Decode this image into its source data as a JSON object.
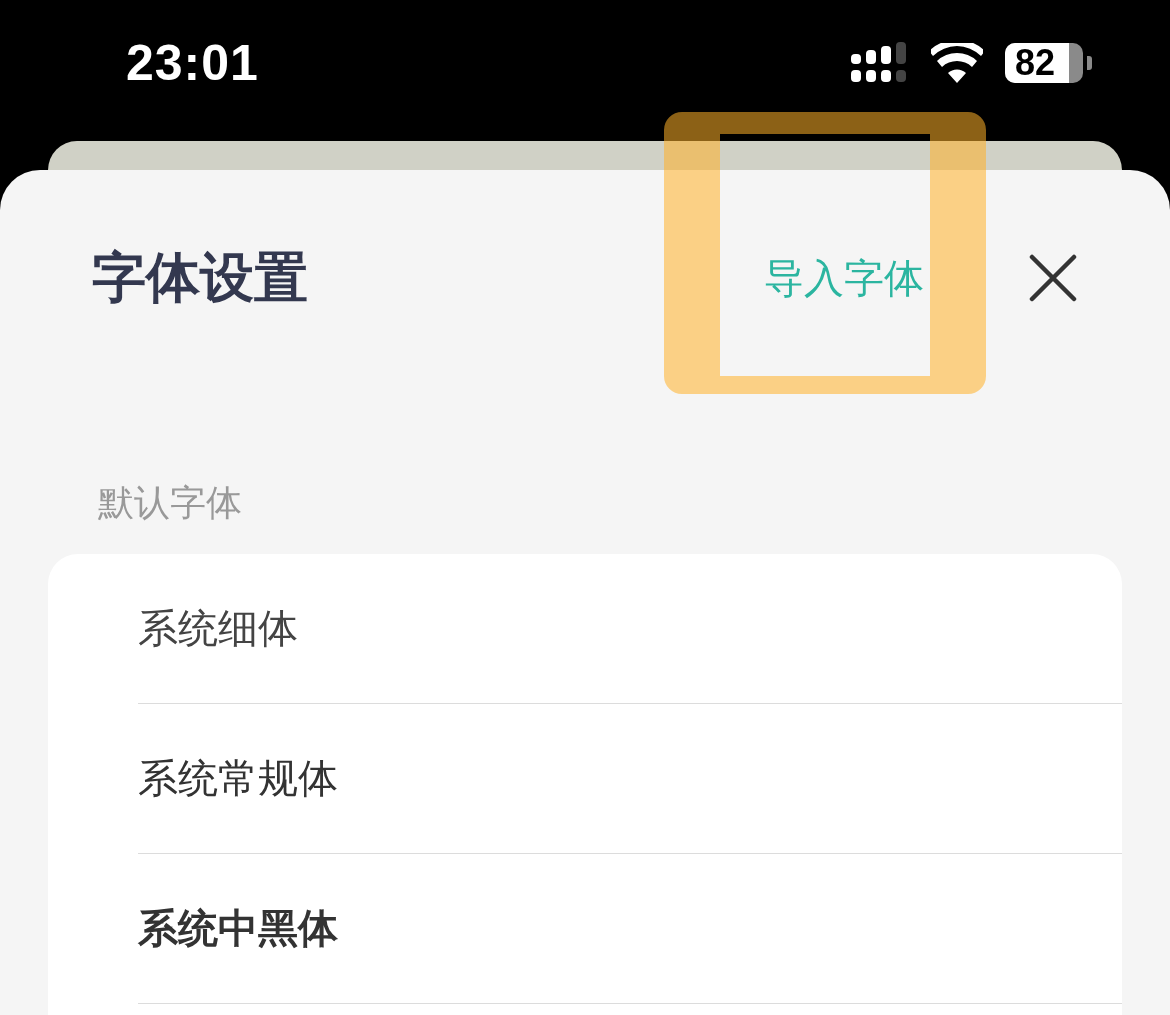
{
  "status_bar": {
    "time": "23:01",
    "battery": "82"
  },
  "sheet": {
    "title": "字体设置",
    "action": "导入字体",
    "highlight": true
  },
  "section": {
    "label": "默认字体"
  },
  "fonts": [
    {
      "label": "系统细体",
      "kind": "light"
    },
    {
      "label": "系统常规体",
      "kind": "regular"
    },
    {
      "label": "系统中黑体",
      "kind": "medium"
    }
  ]
}
